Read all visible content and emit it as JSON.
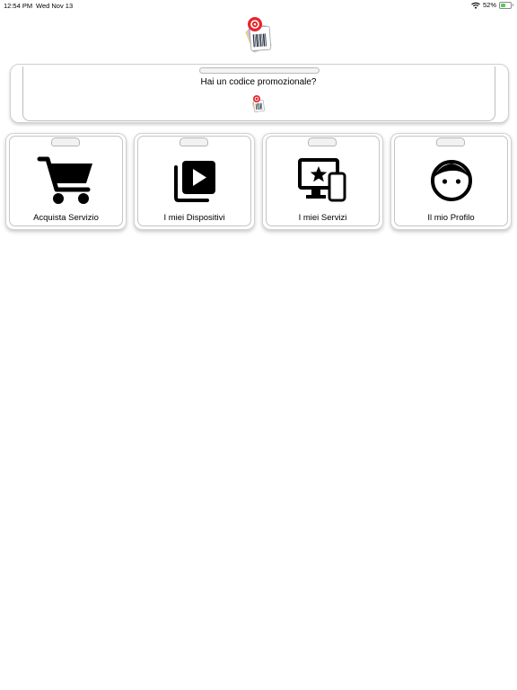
{
  "status_bar": {
    "time": "12:54 PM",
    "date": "Wed Nov 13",
    "battery": "52%",
    "battery_level": 0.52,
    "wifi_icon": "wifi-icon",
    "battery_icon": "battery-icon"
  },
  "app_logo_icon": "barcode-tags-logo",
  "promo": {
    "text": "Hai un codice promozionale?",
    "icon": "promo-code-icon"
  },
  "menu": [
    {
      "label": "Acquista Servizio",
      "icon": "cart-icon"
    },
    {
      "label": "I miei Dispositivi",
      "icon": "video-library-icon"
    },
    {
      "label": "I miei Servizi",
      "icon": "devices-star-icon"
    },
    {
      "label": "Il mio Profilo",
      "icon": "face-icon"
    }
  ],
  "colors": {
    "logo_red": "#e8242c",
    "logo_blue": "#4a7fd6",
    "logo_orange": "#f29a3c",
    "battery_green": "#5ac85a"
  }
}
